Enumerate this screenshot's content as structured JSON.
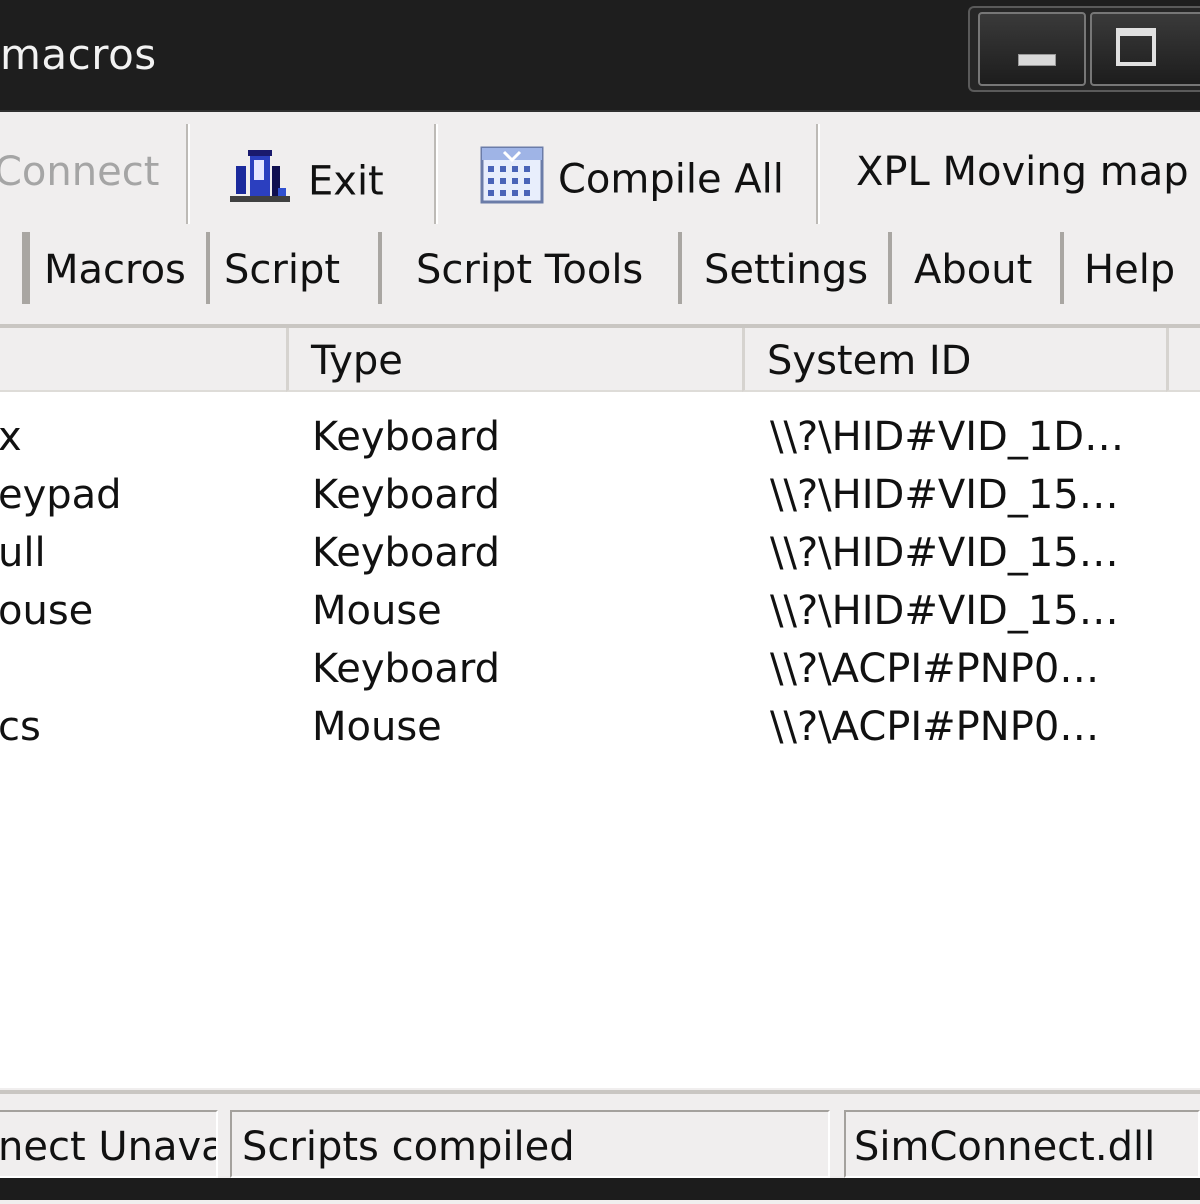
{
  "window": {
    "title": "macros",
    "buttons": {
      "minimize": "minimize",
      "maximize": "maximize"
    }
  },
  "toolbar": {
    "connect_label": "Connect",
    "exit_label": "Exit",
    "compile_label": "Compile All",
    "xpl_label": "XPL Moving map",
    "icons": {
      "exit": "exit-door-icon",
      "compile": "compile-grid-icon"
    }
  },
  "tabs": [
    {
      "label": "Macros"
    },
    {
      "label": "Script"
    },
    {
      "label": "Script Tools"
    },
    {
      "label": "Settings"
    },
    {
      "label": "About"
    },
    {
      "label": "Help"
    }
  ],
  "list": {
    "columns": [
      "",
      "Type",
      "System ID"
    ],
    "rows": [
      {
        "name": "x",
        "type": "Keyboard",
        "id": "\\\\?\\HID#VID_1D…"
      },
      {
        "name": "eypad",
        "type": "Keyboard",
        "id": "\\\\?\\HID#VID_15…"
      },
      {
        "name": "ull",
        "type": "Keyboard",
        "id": "\\\\?\\HID#VID_15…"
      },
      {
        "name": "ouse",
        "type": "Mouse",
        "id": "\\\\?\\HID#VID_15…"
      },
      {
        "name": "",
        "type": "Keyboard",
        "id": "\\\\?\\ACPI#PNP0…"
      },
      {
        "name": "cs",
        "type": "Mouse",
        "id": "\\\\?\\ACPI#PNP0…"
      }
    ]
  },
  "statusbar": {
    "panel1": "nect Unava",
    "panel2": "Scripts compiled",
    "panel3": "SimConnect.dll"
  },
  "colors": {
    "titlebar": "#1e1e1e",
    "face": "#f0eeee",
    "disabled_text": "#a5a5a5"
  }
}
